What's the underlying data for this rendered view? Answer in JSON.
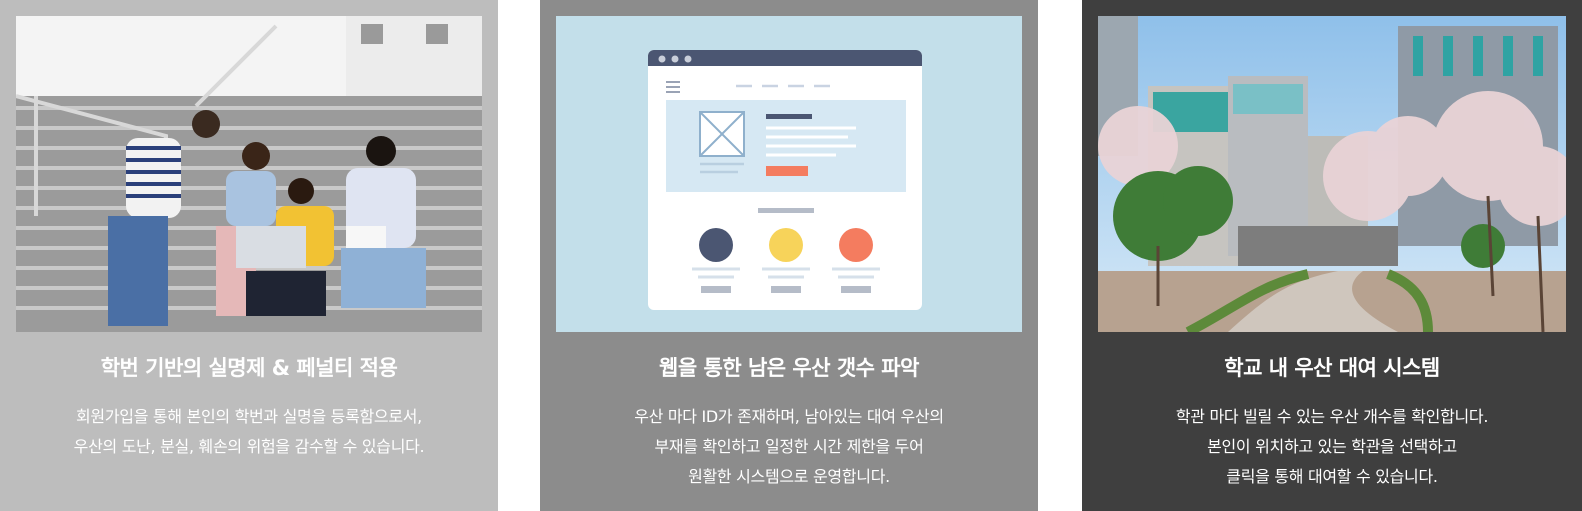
{
  "cards": [
    {
      "title": "학번 기반의 실명제 & 페널티 적용",
      "lines": [
        "회원가입을 통해 본인의 학번과 실명을 등록함으로서,",
        "우산의 도난, 분실, 훼손의 위험을 감수할 수 있습니다."
      ],
      "image": "students-on-stairs-photo"
    },
    {
      "title": "웹을 통한 남은 우산 갯수 파악",
      "lines": [
        "우산 마다 ID가 존재하며,  남아있는 대여 우산의",
        "부재를 확인하고 일정한 시간 제한을 두어",
        "원활한 시스템으로 운영합니다."
      ],
      "image": "website-wireframe-illustration"
    },
    {
      "title": "학교 내 우산 대여 시스템",
      "lines": [
        "학관 마다 빌릴 수 있는 우산 개수를 확인합니다.",
        "본인이 위치하고 있는 학관을 선택하고",
        "클릭을 통해 대여할 수 있습니다."
      ],
      "image": "campus-building-photo"
    }
  ],
  "colors": {
    "card1_bg": "#bdbdbd",
    "card2_bg": "#8c8c8c",
    "card3_bg": "#3f3f3f",
    "text": "#ffffff"
  }
}
